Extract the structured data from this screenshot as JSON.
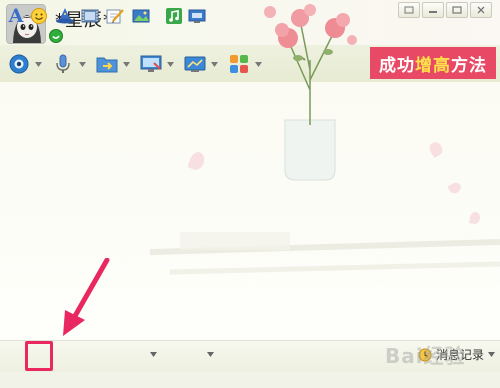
{
  "window": {
    "title": "*星辰*",
    "controls": [
      "restore-icon",
      "minimize-icon",
      "maximize-icon",
      "close-icon"
    ]
  },
  "toolbar": {
    "items": [
      {
        "name": "video-call",
        "icon": "webcam-icon"
      },
      {
        "name": "voice-call",
        "icon": "microphone-icon"
      },
      {
        "name": "send-file",
        "icon": "folder-transfer-icon"
      },
      {
        "name": "remote-assist",
        "icon": "monitor-icon"
      },
      {
        "name": "share-screen",
        "icon": "screen-share-icon"
      },
      {
        "name": "apps",
        "icon": "apps-grid-icon"
      }
    ]
  },
  "banner": {
    "text_before": "成功",
    "text_highlight": "增高",
    "text_after": "方法"
  },
  "bottom_toolbar": {
    "items": [
      {
        "name": "font",
        "icon": "font-a-icon",
        "glyph": "A"
      },
      {
        "name": "emoji",
        "icon": "smiley-icon"
      },
      {
        "name": "magic-emoticon",
        "icon": "magic-hat-icon"
      },
      {
        "name": "vibrate",
        "icon": "film-icon"
      },
      {
        "name": "handwrite",
        "icon": "pen-note-icon"
      },
      {
        "name": "image",
        "icon": "picture-icon"
      },
      {
        "name": "music",
        "icon": "music-icon"
      },
      {
        "name": "screenshot",
        "icon": "screenshot-icon"
      }
    ],
    "history_label": "消息记录"
  },
  "watermark": "Bai经验",
  "colors": {
    "banner_bg": "#e84a66",
    "banner_highlight": "#ffe24a",
    "highlight_box": "#e8285e",
    "annotation_arrow": "#e8285e"
  }
}
